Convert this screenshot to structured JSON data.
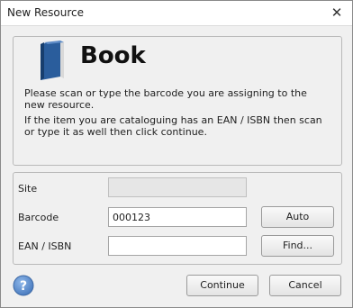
{
  "window": {
    "title": "New Resource",
    "close_glyph": "✕"
  },
  "resource": {
    "type_icon": "book-icon",
    "type_title": "Book",
    "instruction_1": "Please scan or type the barcode you are assigning to the new resource.",
    "instruction_2": "If the item you are cataloguing has an EAN / ISBN then scan or type it as well then click continue."
  },
  "form": {
    "site_label": "Site",
    "site_value": "",
    "barcode_label": "Barcode",
    "barcode_value": "000123",
    "ean_label": "EAN / ISBN",
    "ean_value": "",
    "auto_label": "Auto",
    "find_label": "Find..."
  },
  "footer": {
    "help_icon": "question-icon",
    "continue_label": "Continue",
    "cancel_label": "Cancel"
  },
  "colors": {
    "help_blue": "#5b8fd0",
    "book_blue": "#2a5d9c"
  }
}
